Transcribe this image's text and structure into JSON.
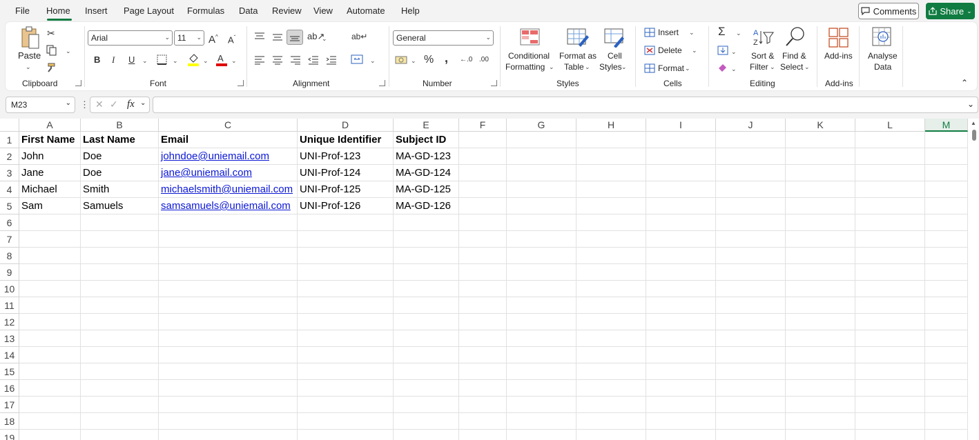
{
  "menu": {
    "items": [
      "File",
      "Home",
      "Insert",
      "Page Layout",
      "Formulas",
      "Data",
      "Review",
      "View",
      "Automate",
      "Help"
    ],
    "comments_label": "Comments",
    "share_label": "Share"
  },
  "ribbon": {
    "clipboard": {
      "paste": "Paste",
      "label": "Clipboard"
    },
    "font": {
      "name": "Arial",
      "size": "11",
      "label": "Font",
      "bold": "B",
      "italic": "I",
      "underline": "U"
    },
    "alignment": {
      "label": "Alignment"
    },
    "number": {
      "format": "General",
      "label": "Number",
      "percent": "%",
      "comma": ","
    },
    "styles": {
      "conditional_1": "Conditional",
      "conditional_2": "Formatting",
      "format_table_1": "Format as",
      "format_table_2": "Table",
      "cell_styles_1": "Cell",
      "cell_styles_2": "Styles",
      "label": "Styles"
    },
    "cells": {
      "insert": "Insert",
      "delete": "Delete",
      "format": "Format",
      "label": "Cells"
    },
    "editing": {
      "sort_1": "Sort &",
      "sort_2": "Filter",
      "find_1": "Find &",
      "find_2": "Select",
      "label": "Editing"
    },
    "addins": {
      "addins": "Add-ins",
      "label": "Add-ins"
    },
    "analyse": {
      "line1": "Analyse",
      "line2": "Data"
    }
  },
  "formula_bar": {
    "name_box": "M23",
    "fx": "fx",
    "formula": ""
  },
  "colors": {
    "accent": "#107c41",
    "link": "#0b17d6"
  },
  "grid": {
    "columns": [
      "A",
      "B",
      "C",
      "D",
      "E",
      "F",
      "G",
      "H",
      "I",
      "J",
      "K",
      "L",
      "M"
    ],
    "selected_column": "M",
    "rows": [
      "1",
      "2",
      "3",
      "4",
      "5",
      "6",
      "7",
      "8",
      "9",
      "10",
      "11",
      "12",
      "13",
      "14",
      "15",
      "16",
      "17",
      "18",
      "19"
    ],
    "headers": [
      "First Name",
      "Last Name",
      "Email",
      "Unique Identifier",
      "Subject ID"
    ],
    "data": [
      [
        "John",
        "Doe",
        "johndoe@uniemail.com",
        "UNI-Prof-123",
        "MA-GD-123"
      ],
      [
        "Jane",
        "Doe",
        "jane@uniemail.com",
        "UNI-Prof-124",
        "MA-GD-124"
      ],
      [
        "Michael",
        "Smith",
        "michaelsmith@uniemail.com",
        "UNI-Prof-125",
        "MA-GD-125"
      ],
      [
        "Sam",
        "Samuels",
        "samsamuels@uniemail.com",
        "UNI-Prof-126",
        "MA-GD-126"
      ]
    ]
  }
}
